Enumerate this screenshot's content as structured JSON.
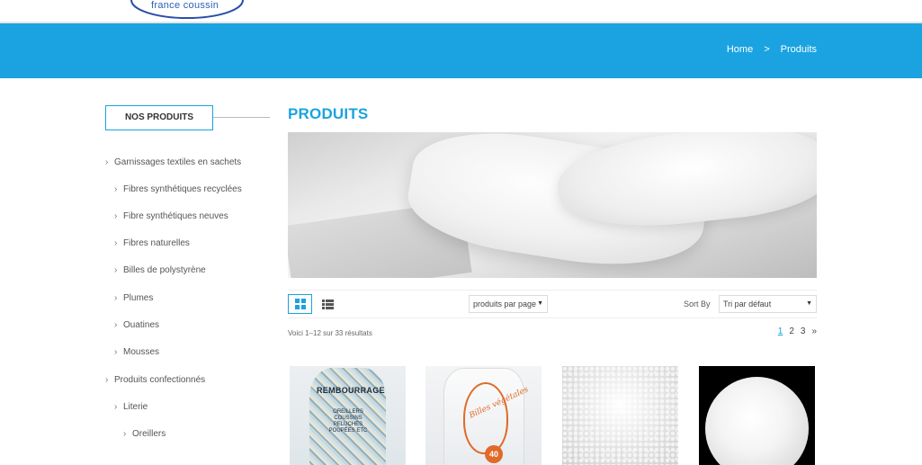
{
  "brand": {
    "logo_text": "france coussin"
  },
  "breadcrumb": {
    "home": "Home",
    "separator": ">",
    "current": "Produits"
  },
  "sidebar": {
    "title": "NOS PRODUITS",
    "items": [
      {
        "label": "Garnissages textiles en sachets",
        "level": 0
      },
      {
        "label": "Fibres synthétiques recyclées",
        "level": 1
      },
      {
        "label": "Fibre synthétiques neuves",
        "level": 1
      },
      {
        "label": "Fibres naturelles",
        "level": 1
      },
      {
        "label": "Billes de polystyrène",
        "level": 1
      },
      {
        "label": "Plumes",
        "level": 1
      },
      {
        "label": "Ouatines",
        "level": 1
      },
      {
        "label": "Mousses",
        "level": 1
      },
      {
        "label": "Produits confectionnés",
        "level": 0
      },
      {
        "label": "Literie",
        "level": 1
      },
      {
        "label": "Oreillers",
        "level": 2
      }
    ]
  },
  "main": {
    "title": "PRODUITS",
    "toolbar": {
      "per_page": "produits par page",
      "sort_label": "Sort By",
      "sort_value": "Tri par défaut"
    },
    "result_count": "Voici 1–12 sur 33 résultats",
    "pagination": [
      "1",
      "2",
      "3",
      "»"
    ],
    "current_page": "1",
    "products": [
      {
        "label": "REMBOURRAGE",
        "sub": "OREILLERS COUSSINS PELUCHES POUPÉES ETC"
      },
      {
        "label": "Billes végétales",
        "sub": "40"
      },
      {
        "label": ""
      },
      {
        "label": ""
      }
    ]
  },
  "colors": {
    "accent": "#1aa3e0",
    "banner": "#1aa3e0",
    "text": "#555555"
  },
  "icons": [
    "grid-view-icon",
    "list-view-icon",
    "chevron-right-icon",
    "caret-down-icon"
  ]
}
